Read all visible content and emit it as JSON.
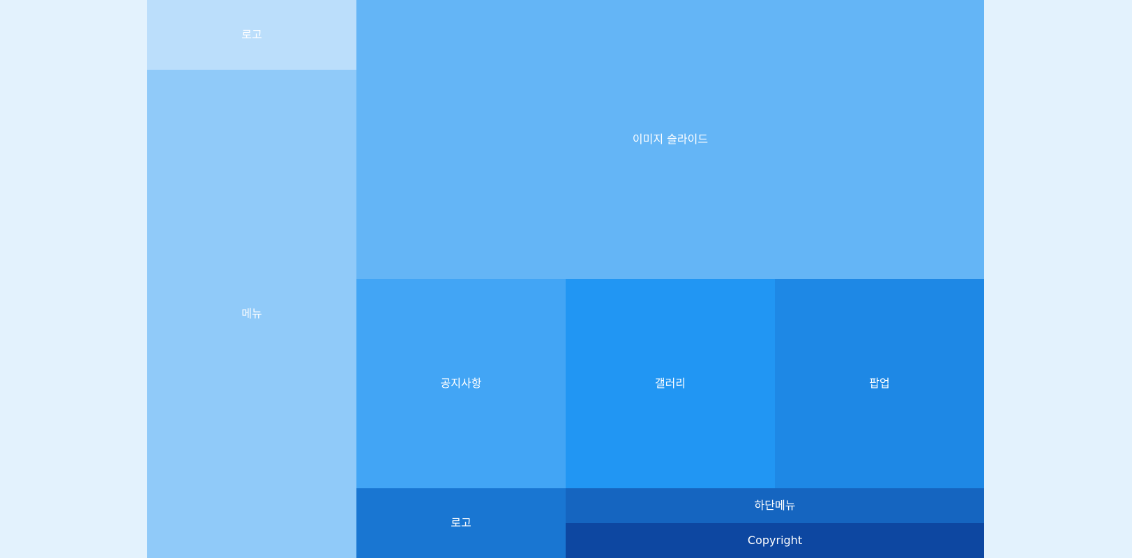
{
  "header": {
    "logo_label": "로고",
    "menu_label": "메뉴"
  },
  "main": {
    "slider_label": "이미지 슬라이드",
    "notice_label": "공지사항",
    "gallery_label": "갤러리",
    "popup_label": "팝업"
  },
  "footer": {
    "logo_label": "로고",
    "menu_label": "하단메뉴",
    "copyright_label": "Copyright"
  },
  "colors": {
    "page_background": "#e3f2fd",
    "logo_top": "#bbdefb",
    "menu": "#90caf9",
    "slider": "#64b5f6",
    "notice": "#42a5f5",
    "gallery": "#2196f3",
    "popup": "#1e88e5",
    "footer_logo": "#1976d2",
    "footer_menu": "#1565c0",
    "copyright": "#0d47a1"
  }
}
